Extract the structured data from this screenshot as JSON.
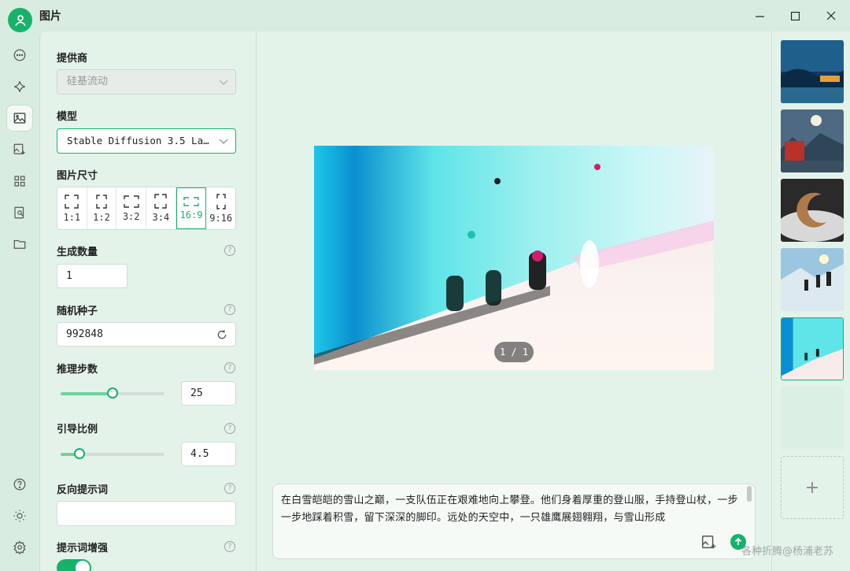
{
  "window": {
    "title": "图片"
  },
  "settings": {
    "provider": {
      "label": "提供商",
      "value": "硅基流动"
    },
    "model": {
      "label": "模型",
      "value": "Stable Diffusion 3.5 La…"
    },
    "size": {
      "label": "图片尺寸",
      "options": [
        "1:1",
        "1:2",
        "3:2",
        "3:4",
        "16:9",
        "9:16"
      ],
      "selected": "16:9"
    },
    "count": {
      "label": "生成数量",
      "value": "1"
    },
    "seed": {
      "label": "随机种子",
      "value": "992848"
    },
    "steps": {
      "label": "推理步数",
      "value": "25",
      "level": 0.5
    },
    "guidance": {
      "label": "引导比例",
      "value": "4.5",
      "level": 0.18
    },
    "negative_prompt": {
      "label": "反向提示词",
      "value": ""
    },
    "prompt_enhance": {
      "label": "提示词增强",
      "enabled": true
    }
  },
  "preview": {
    "counter": "1 / 1"
  },
  "prompt": {
    "text": "在白雪皑皑的雪山之巅，一支队伍正在艰难地向上攀登。他们身着厚重的登山服，手持登山杖，一步一步地踩着积雪，留下深深的脚印。远处的天空中，一只雄鹰展翅翱翔，与雪山形成"
  },
  "watermark": "各种折腾@杨浦老苏",
  "icons": {
    "nav": [
      "chat-icon",
      "sparkle-icon",
      "image-icon",
      "image-edit-icon",
      "apps-icon",
      "doc-search-icon",
      "folder-icon"
    ],
    "bottom": [
      "help-icon",
      "sun-icon",
      "settings-icon"
    ]
  },
  "colors": {
    "accent": "#16b26b",
    "background": "#e4f3ea"
  }
}
